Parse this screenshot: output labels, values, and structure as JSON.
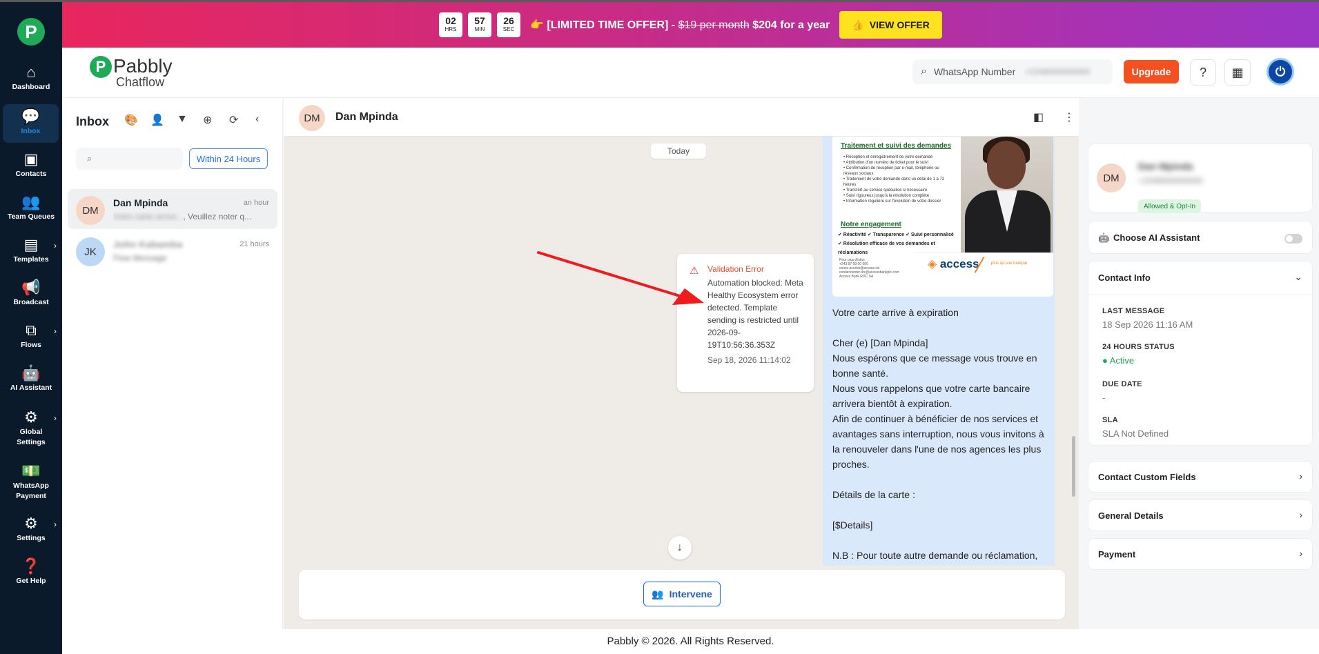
{
  "promo": {
    "hours": "02",
    "hours_label": "HRS",
    "minutes": "57",
    "minutes_label": "MIN",
    "seconds": "26",
    "seconds_label": "SEC",
    "emoji": "👉",
    "offer_prefix": "[LIMITED TIME OFFER] -",
    "old_price": "$19 per month",
    "new_price": "$204 for a year",
    "cta": "VIEW OFFER"
  },
  "sidebar": {
    "logo": "P",
    "items": [
      {
        "label": "Dashboard",
        "icon": "home-icon"
      },
      {
        "label": "Inbox",
        "icon": "chat-icon",
        "active": true
      },
      {
        "label": "Contacts",
        "icon": "contact-card-icon"
      },
      {
        "label": "Team Queues",
        "icon": "team-icon"
      },
      {
        "label": "Templates",
        "icon": "template-icon"
      },
      {
        "label": "Broadcast",
        "icon": "megaphone-icon"
      },
      {
        "label": "Flows",
        "icon": "flow-icon"
      },
      {
        "label": "AI Assistant",
        "icon": "robot-icon"
      },
      {
        "label": "Global Settings",
        "icon": "global-settings-icon"
      },
      {
        "label": "WhatsApp Payment",
        "icon": "payment-icon"
      },
      {
        "label": "Settings",
        "icon": "gear-icon"
      },
      {
        "label": "Get Help",
        "icon": "help-icon"
      }
    ]
  },
  "header": {
    "brand_line1": "Pabbly",
    "brand_line2": "Chatflow",
    "search_label": "WhatsApp Number",
    "search_value": "+2348000000000",
    "upgrade": "Upgrade"
  },
  "inbox": {
    "title": "Inbox",
    "search_placeholder": "",
    "filter_button": "Within 24 Hours",
    "chats": [
      {
        "initials": "DM",
        "name": "Dan Mpinda",
        "time": "an hour",
        "preview_blurred": "Votre carte arrive...",
        "preview": ", Veuillez noter q..."
      },
      {
        "initials": "JK",
        "name": "John Kabamba",
        "time": "21 hours",
        "preview": "Flow Message"
      }
    ]
  },
  "chat": {
    "initials": "DM",
    "name": "Dan Mpinda",
    "date_chip": "Today",
    "error": {
      "title": "Validation Error",
      "body": "Automation blocked: Meta Healthy Ecosystem error detected. Template sending is restricted until 2026-09-19T10:56:36.353Z",
      "date": "Sep 18, 2026 11:14:02"
    },
    "image": {
      "heading1": "Traitement et suivi des demandes",
      "bullets": "• Réception et enregistrement de votre demande\n• Attribution d'un numéro de ticket pour le suivi\n• Confirmation de réception par e-mail, téléphone ou réseaux sociaux.\n• Traitement de votre demande dans un délai de 1 à 72 heures\n• Transfert au service spécialisé si nécessaire\n• Suivi rigoureux jusqu'à la résolution complète\n• Information régulière sur l'évolution de votre dossier",
      "heading2": "Notre engagement",
      "engagement": "✔ Réactivité ✔ Transparence ✔ Suivi personnalisé\n✔ Résolution efficace de vos demandes et réclamations",
      "small": "Pour plus d'infos\n+243 97 00 00 000\nconso.access@access.cd\ncontactcenter.drc@accessbankplc.com\nAccess Bank RDC SA",
      "brand": "access",
      "tagline": "plus qu'une banque"
    },
    "message": [
      "Votre carte arrive à expiration",
      "Cher (e) [Dan Mpinda]\nNous espérons que ce message vous trouve en bonne santé.\nNous vous rappelons que votre carte bancaire arrivera bientôt à expiration.\nAfin de continuer à bénéficier de nos services et avantages sans interruption, nous vous invitons à la renouveler dans l'une de nos agences les plus proches.",
      "Détails de la carte :",
      "[$Details]",
      "N.B : Pour toute autre demande ou réclamation, veuillez utiliser les coordonnées indiquées dans"
    ],
    "intervene": "Intervene"
  },
  "contact": {
    "initials": "DM",
    "name": "Dan Mpinda",
    "number": "+2348000000000",
    "badge": "Allowed & Opt-In",
    "ai_label": "Choose AI Assistant",
    "info_title": "Contact Info",
    "fields": [
      {
        "label": "LAST MESSAGE",
        "value": "18 Sep 2026 11:16 AM"
      },
      {
        "label": "24 HOURS STATUS",
        "value": "Active"
      },
      {
        "label": "DUE DATE",
        "value": "-"
      },
      {
        "label": "SLA",
        "value": "SLA Not Defined"
      }
    ],
    "sections": [
      "Contact Custom Fields",
      "General Details",
      "Payment"
    ]
  },
  "footer": "Pabbly © 2026. All Rights Reserved.",
  "colors": {
    "accent": "#1e88e5",
    "upgrade": "#f55022",
    "error": "#e53935",
    "bubble": "#d9e8fb",
    "sidebar": "#0b1a2a"
  }
}
